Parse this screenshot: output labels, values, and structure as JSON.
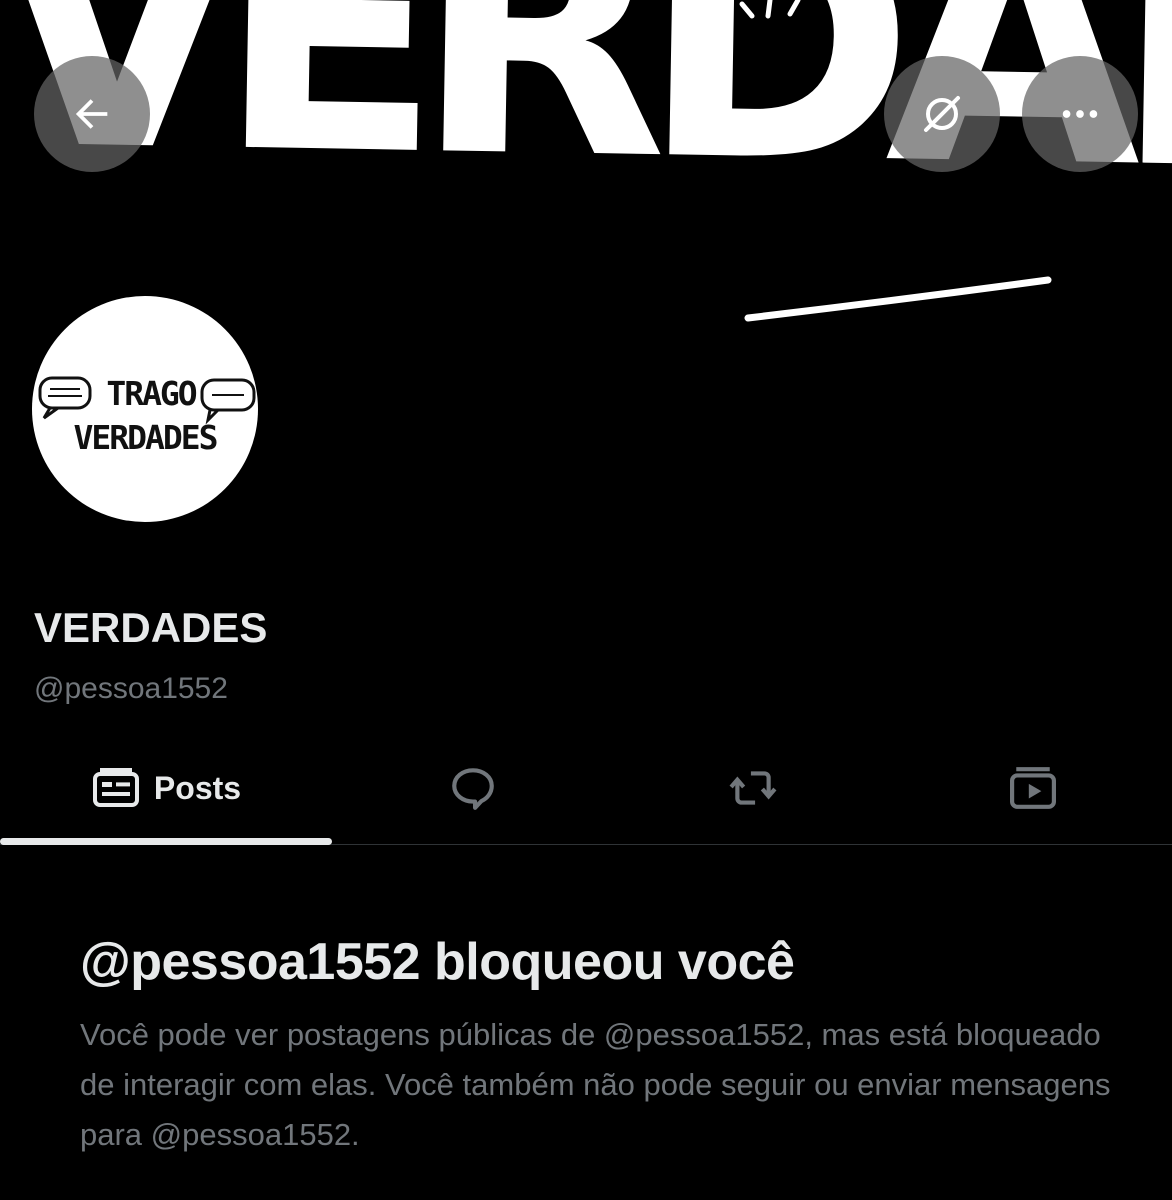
{
  "header": {
    "banner_text": "VERDADES!",
    "back_icon": "arrow-left-icon",
    "grok_icon": "grok-icon",
    "more_icon": "more-horizontal-icon"
  },
  "avatar": {
    "line1": "TRAGO",
    "line2": "VERDADES"
  },
  "profile": {
    "name": "VERDADES",
    "handle": "@pessoa1552"
  },
  "tabs": {
    "posts_label": "Posts",
    "posts_icon": "posts-icon",
    "replies_icon": "speech-bubble-icon",
    "reposts_icon": "repost-icon",
    "media_icon": "media-icon"
  },
  "blocked": {
    "title": "@pessoa1552 bloqueou você",
    "description": "Você pode ver postagens públicas de @pessoa1552, mas está bloqueado de interagir com elas. Você também não pode seguir ou enviar mensagens para @pessoa1552."
  },
  "colors": {
    "background": "#000000",
    "text_primary": "#e7e9ea",
    "text_secondary": "#71767b",
    "divider": "#2f3336"
  }
}
